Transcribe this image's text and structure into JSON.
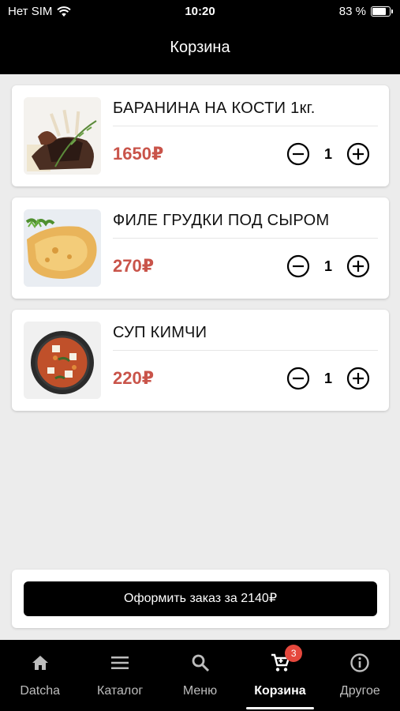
{
  "status_bar": {
    "carrier": "Нет SIM",
    "time": "10:20",
    "battery_text": "83 %",
    "battery_level": 0.83
  },
  "header": {
    "title": "Корзина"
  },
  "cart": {
    "items": [
      {
        "title": "БАРАНИНА НА КОСТИ 1кг.",
        "price": "1650₽",
        "quantity": "1",
        "image": "lamb-ribs-image"
      },
      {
        "title": "ФИЛЕ ГРУДКИ ПОД СЫРОМ",
        "price": "270₽",
        "quantity": "1",
        "image": "chicken-cheese-image"
      },
      {
        "title": "СУП КИМЧИ",
        "price": "220₽",
        "quantity": "1",
        "image": "kimchi-soup-image"
      }
    ]
  },
  "checkout": {
    "button_label": "Оформить заказ за 2140₽"
  },
  "tab_bar": {
    "tabs": [
      {
        "label": "Datcha",
        "icon": "home-icon"
      },
      {
        "label": "Каталог",
        "icon": "menu-lines-icon"
      },
      {
        "label": "Меню",
        "icon": "search-icon"
      },
      {
        "label": "Корзина",
        "icon": "cart-icon",
        "badge": "3",
        "active": true
      },
      {
        "label": "Другое",
        "icon": "info-icon"
      }
    ]
  },
  "colors": {
    "accent_price": "#c9544a",
    "badge": "#e5483d",
    "bars": "#000000"
  }
}
